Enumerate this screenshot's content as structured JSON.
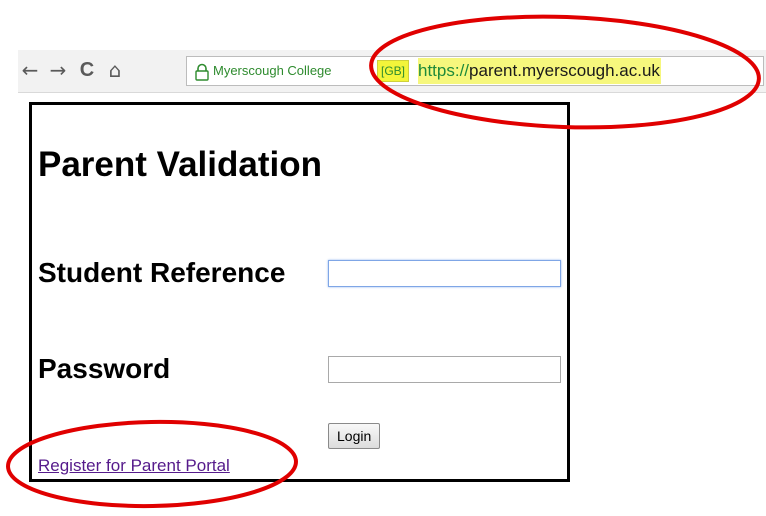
{
  "browser": {
    "nav": {
      "back_glyph": "←",
      "forward_glyph": "→",
      "reload_glyph": "C",
      "home_glyph": "⌂"
    },
    "address_bar": {
      "ev_name": "Myerscough College",
      "country": "[GB]",
      "scheme": "https://",
      "host": "parent.myerscough.ac.uk",
      "lock_icon": "lock-icon"
    }
  },
  "page": {
    "title": "Parent Validation",
    "student_reference_label": "Student Reference",
    "student_reference_value": "",
    "password_label": "Password",
    "password_value": "",
    "login_button": "Login",
    "register_link": "Register for Parent Portal"
  },
  "annotations": {
    "color": "#e00000",
    "highlight_color": "#f6f77d"
  }
}
